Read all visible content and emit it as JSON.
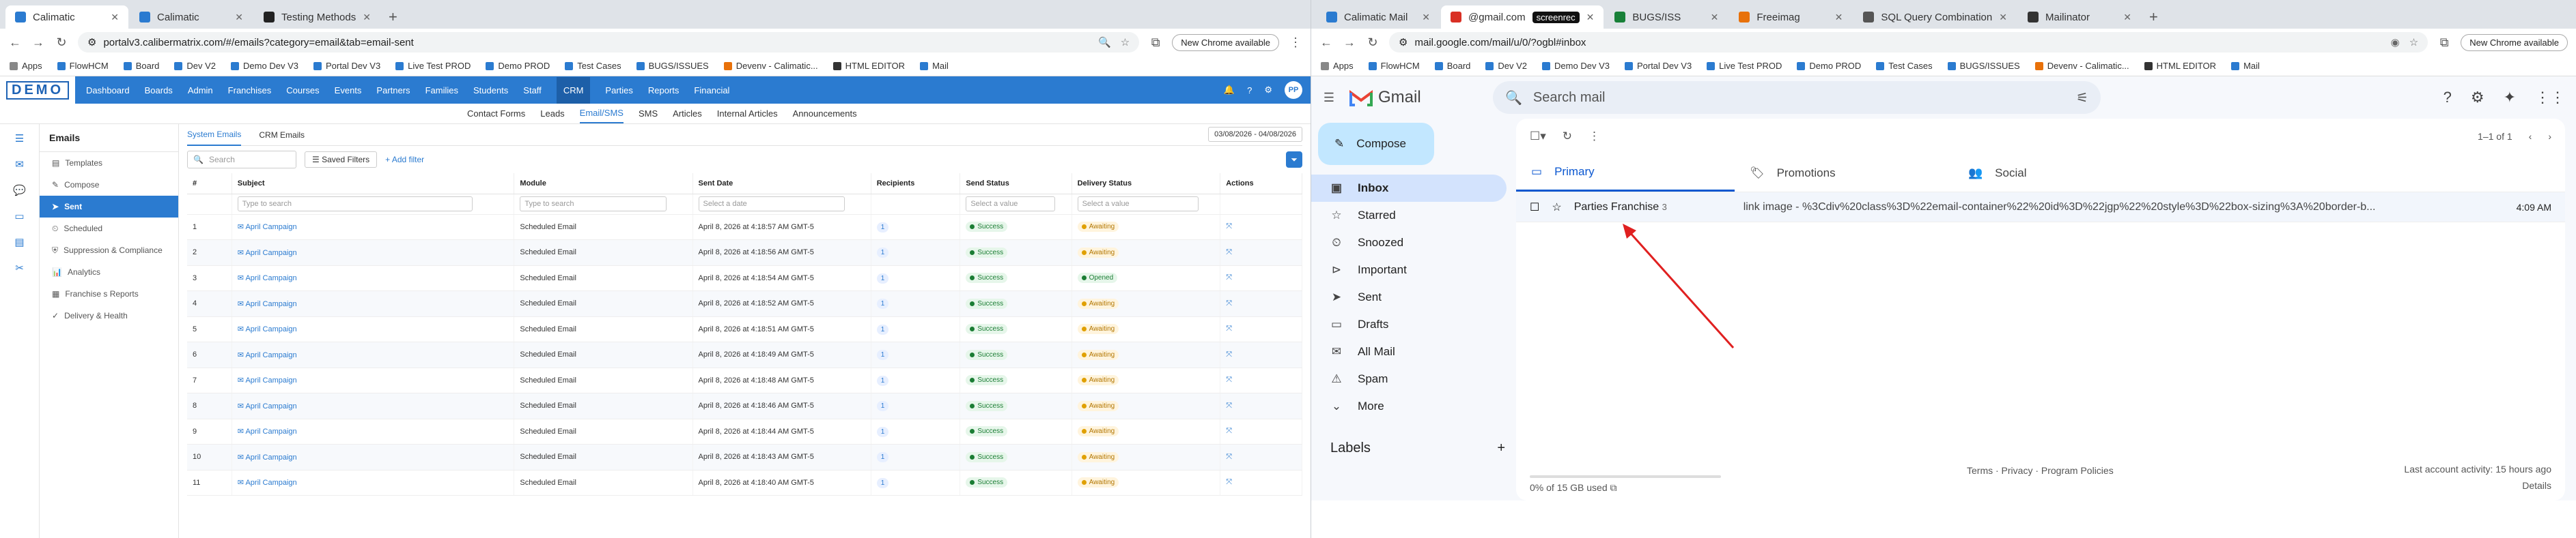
{
  "left": {
    "tabs": [
      {
        "title": "Calimatic",
        "color": "#2b7bd0"
      },
      {
        "title": "Calimatic",
        "color": "#2b7bd0"
      },
      {
        "title": "Testing Methods",
        "color": "#222"
      }
    ],
    "url": "portalv3.calibermatrix.com/#/emails?category=email&tab=email-sent",
    "chrome_new": "New Chrome available",
    "bookmarks": [
      "Apps",
      "FlowHCM",
      "Board",
      "Dev V2",
      "Demo Dev V3",
      "Portal Dev V3",
      "Live Test PROD",
      "Demo PROD",
      "Test Cases",
      "BUGS/ISSUES",
      "Devenv - Calimatic...",
      "HTML EDITOR",
      "Mail"
    ],
    "logo": "DEMO",
    "nav": [
      "Dashboard",
      "Boards",
      "Admin",
      "Franchises",
      "Courses",
      "Events",
      "Partners",
      "Families",
      "Students",
      "Staff",
      "CRM",
      "Parties",
      "Reports",
      "Financial"
    ],
    "nav_active": "CRM",
    "avatar": "PP",
    "subnav": [
      "Contact Forms",
      "Leads",
      "Email/SMS",
      "SMS",
      "Articles",
      "Internal Articles",
      "Announcements"
    ],
    "subnav_active": "Email/SMS",
    "side_title": "Emails",
    "side_items": [
      "Templates",
      "Compose",
      "Sent",
      "Scheduled",
      "Suppression & Compliance",
      "Analytics",
      "Franchise s Reports",
      "Delivery & Health"
    ],
    "side_active": "Sent",
    "content_tabs": [
      "System Emails",
      "CRM Emails"
    ],
    "date_range": "03/08/2026 - 04/08/2026",
    "search_placeholder": "Search",
    "saved_filters": "Saved Filters",
    "add_filter": "Add filter",
    "columns": [
      "#",
      "Subject",
      "Module",
      "Sent Date",
      "Recipients",
      "Send Status",
      "Delivery Status",
      "Actions"
    ],
    "filter_placeholders": [
      "Type to search",
      "Type to search",
      "Select a date",
      "Select a value",
      "Select a value"
    ],
    "rows": [
      {
        "n": "1",
        "subject": "April Campaign",
        "module": "Scheduled Email",
        "date": "April 8, 2026 at 4:18:57 AM GMT-5",
        "rcp": "1",
        "send": "Success",
        "delivery": "Awaiting"
      },
      {
        "n": "2",
        "subject": "April Campaign",
        "module": "Scheduled Email",
        "date": "April 8, 2026 at 4:18:56 AM GMT-5",
        "rcp": "1",
        "send": "Success",
        "delivery": "Awaiting"
      },
      {
        "n": "3",
        "subject": "April Campaign",
        "module": "Scheduled Email",
        "date": "April 8, 2026 at 4:18:54 AM GMT-5",
        "rcp": "1",
        "send": "Success",
        "delivery": "Opened"
      },
      {
        "n": "4",
        "subject": "April Campaign",
        "module": "Scheduled Email",
        "date": "April 8, 2026 at 4:18:52 AM GMT-5",
        "rcp": "1",
        "send": "Success",
        "delivery": "Awaiting"
      },
      {
        "n": "5",
        "subject": "April Campaign",
        "module": "Scheduled Email",
        "date": "April 8, 2026 at 4:18:51 AM GMT-5",
        "rcp": "1",
        "send": "Success",
        "delivery": "Awaiting"
      },
      {
        "n": "6",
        "subject": "April Campaign",
        "module": "Scheduled Email",
        "date": "April 8, 2026 at 4:18:49 AM GMT-5",
        "rcp": "1",
        "send": "Success",
        "delivery": "Awaiting"
      },
      {
        "n": "7",
        "subject": "April Campaign",
        "module": "Scheduled Email",
        "date": "April 8, 2026 at 4:18:48 AM GMT-5",
        "rcp": "1",
        "send": "Success",
        "delivery": "Awaiting"
      },
      {
        "n": "8",
        "subject": "April Campaign",
        "module": "Scheduled Email",
        "date": "April 8, 2026 at 4:18:46 AM GMT-5",
        "rcp": "1",
        "send": "Success",
        "delivery": "Awaiting"
      },
      {
        "n": "9",
        "subject": "April Campaign",
        "module": "Scheduled Email",
        "date": "April 8, 2026 at 4:18:44 AM GMT-5",
        "rcp": "1",
        "send": "Success",
        "delivery": "Awaiting"
      },
      {
        "n": "10",
        "subject": "April Campaign",
        "module": "Scheduled Email",
        "date": "April 8, 2026 at 4:18:43 AM GMT-5",
        "rcp": "1",
        "send": "Success",
        "delivery": "Awaiting"
      },
      {
        "n": "11",
        "subject": "April Campaign",
        "module": "Scheduled Email",
        "date": "April 8, 2026 at 4:18:40 AM GMT-5",
        "rcp": "1",
        "send": "Success",
        "delivery": "Awaiting"
      }
    ]
  },
  "right": {
    "tabs": [
      {
        "title": "Calimatic Mail",
        "color": "#2b7bd0"
      },
      {
        "title": "@gmail.com",
        "color": "#d93025"
      },
      {
        "title": "BUGS/ISS",
        "color": "#188038"
      },
      {
        "title": "Freeimag",
        "color": "#e8710a"
      },
      {
        "title": "SQL Query Combination",
        "color": "#555"
      },
      {
        "title": "Mailinator",
        "color": "#333"
      }
    ],
    "recording_badge": "screenrec",
    "url": "mail.google.com/mail/u/0/?ogbl#inbox",
    "chrome_new": "New Chrome available",
    "bookmarks": [
      "Apps",
      "FlowHCM",
      "Board",
      "Dev V2",
      "Demo Dev V3",
      "Portal Dev V3",
      "Live Test PROD",
      "Demo PROD",
      "Test Cases",
      "BUGS/ISSUES",
      "Devenv - Calimatic...",
      "HTML EDITOR",
      "Mail"
    ],
    "gmail_title": "Gmail",
    "search_placeholder": "Search mail",
    "compose": "Compose",
    "nav": [
      "Inbox",
      "Starred",
      "Snoozed",
      "Important",
      "Sent",
      "Drafts",
      "All Mail",
      "Spam",
      "More"
    ],
    "nav_active": "Inbox",
    "labels": "Labels",
    "pager": "1–1 of 1",
    "inbox_tabs": [
      "Primary",
      "Promotions",
      "Social"
    ],
    "inbox_active": "Primary",
    "mail": {
      "from": "Parties Franchise",
      "count": "3",
      "subject": "link image - %3Cdiv%20class%3D%22email-container%22%20id%3D%22jgp%22%20style%3D%22box-sizing%3A%20border-b...",
      "time": "4:09 AM"
    },
    "storage": "0% of 15 GB used",
    "policies": "Terms · Privacy · Program Policies",
    "last_activity": "Last account activity: 15 hours ago",
    "details": "Details"
  },
  "colors": {
    "calimatic_blue": "#2b7bd0",
    "gmail_selected": "#d3e3fd",
    "arrow": "#e02020"
  }
}
